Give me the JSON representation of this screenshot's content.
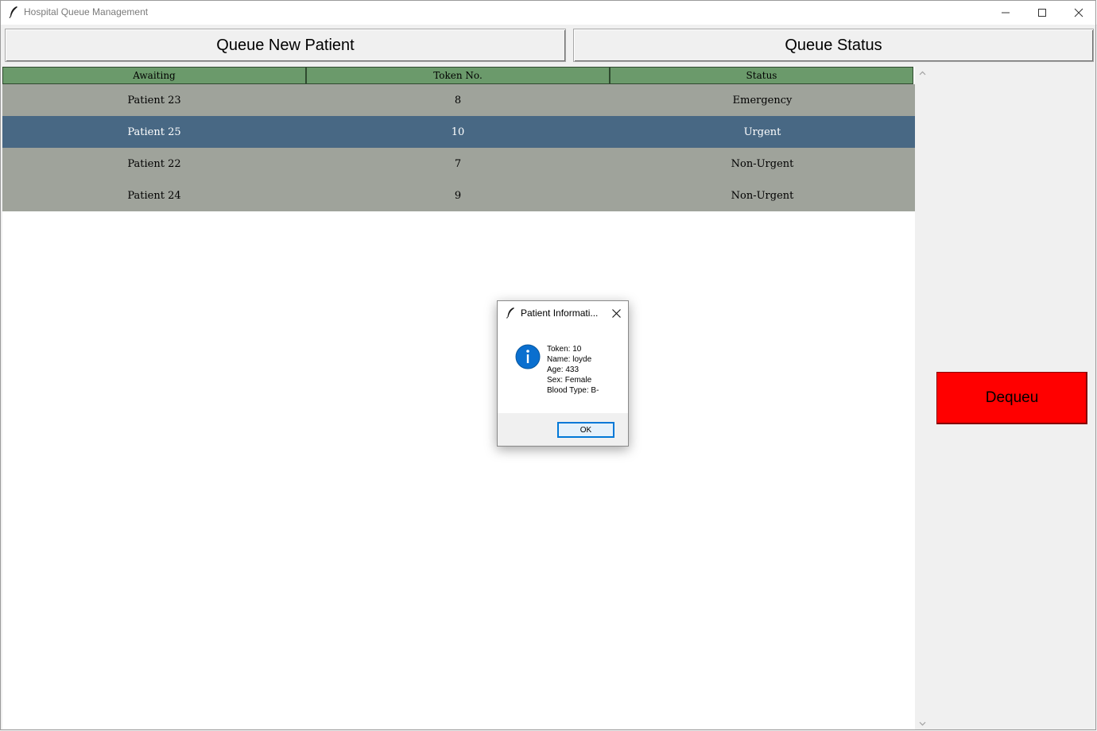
{
  "window": {
    "title": "Hospital Queue Management",
    "icon": "feather-icon"
  },
  "toolbar": {
    "queue_new_label": "Queue New Patient",
    "queue_status_label": "Queue Status"
  },
  "table": {
    "columns": [
      "Awaiting",
      "Token No.",
      "Status"
    ],
    "header_color": "#6b9a6b",
    "row_color": "#9fa39b",
    "selected_color": "#486884",
    "rows": [
      {
        "awaiting": "Patient 23",
        "token": "8",
        "status": "Emergency",
        "selected": false
      },
      {
        "awaiting": "Patient 25",
        "token": "10",
        "status": "Urgent",
        "selected": true
      },
      {
        "awaiting": "Patient 22",
        "token": "7",
        "status": "Non-Urgent",
        "selected": false
      },
      {
        "awaiting": "Patient 24",
        "token": "9",
        "status": "Non-Urgent",
        "selected": false
      }
    ]
  },
  "actions": {
    "dequeue_label": "Dequeu",
    "dequeue_color": "#ff0000"
  },
  "dialog": {
    "title": "Patient Informati...",
    "icon": "info-icon",
    "lines": [
      "Token: 10",
      "Name: loyde",
      "Age: 433",
      "Sex: Female",
      "Blood Type: B-"
    ],
    "ok_label": "OK"
  }
}
